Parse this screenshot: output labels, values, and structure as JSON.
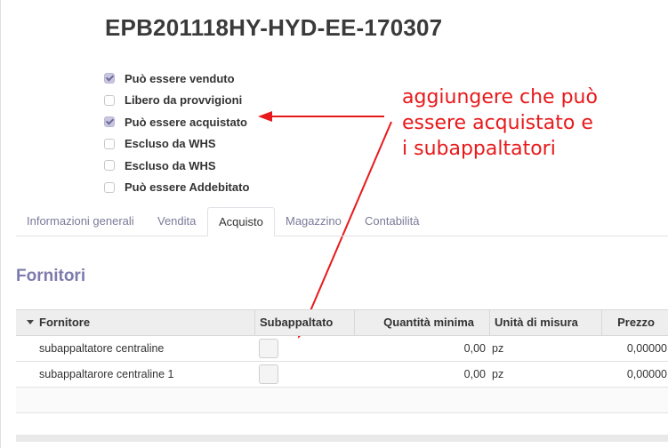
{
  "product": {
    "title": "EPB201118HY-HYD-EE-170307"
  },
  "checkboxes": [
    {
      "label": "Può essere venduto",
      "checked": true
    },
    {
      "label": "Libero da provvigioni",
      "checked": false
    },
    {
      "label": "Può essere acquistato",
      "checked": true
    },
    {
      "label": "Escluso da WHS",
      "checked": false
    },
    {
      "label": "Escluso da WHS",
      "checked": false
    },
    {
      "label": "Può essere Addebitato",
      "checked": false
    }
  ],
  "annotation": {
    "lines": [
      "aggiungere che può",
      "essere acquistato e",
      "i subappaltatori"
    ],
    "color": "#e8191b"
  },
  "tabs": [
    {
      "label": "Informazioni generali",
      "active": false
    },
    {
      "label": "Vendita",
      "active": false
    },
    {
      "label": "Acquisto",
      "active": true
    },
    {
      "label": "Magazzino",
      "active": false
    },
    {
      "label": "Contabilità",
      "active": false
    }
  ],
  "section": {
    "title": "Fornitori"
  },
  "table": {
    "headers": [
      "Fornitore",
      "Subappaltato",
      "Quantità minima",
      "Unità di misura",
      "Prezzo"
    ],
    "rows": [
      {
        "fornitore": "subappaltatore centraline",
        "subappaltato": false,
        "quantita": "0,00",
        "unita": "pz",
        "prezzo": "0,00000"
      },
      {
        "fornitore": "subappaltarore centraline 1",
        "subappaltato": false,
        "quantita": "0,00",
        "unita": "pz",
        "prezzo": "0,00000"
      }
    ]
  },
  "colors": {
    "accent": "#7c7bad",
    "checked": "#c9c7df"
  }
}
